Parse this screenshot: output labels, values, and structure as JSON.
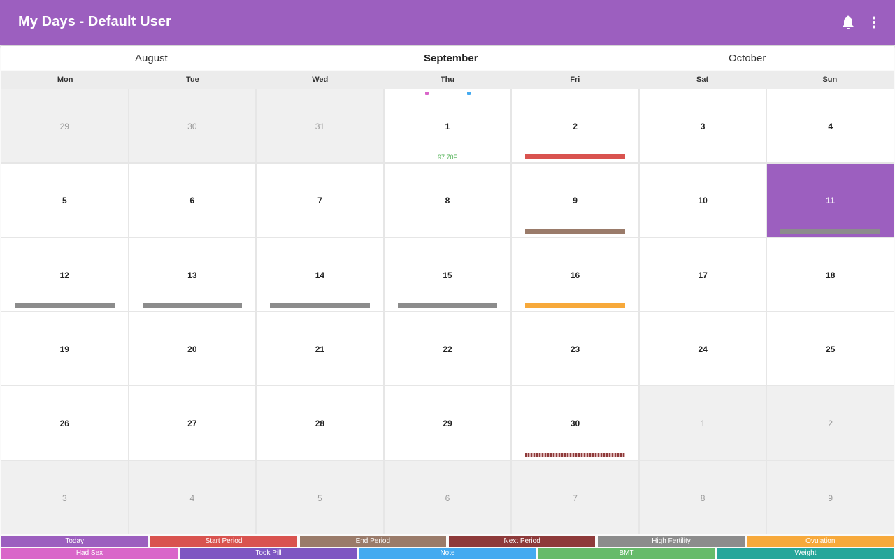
{
  "app": {
    "title": "My Days - Default User"
  },
  "icons": {
    "bell": "bell-icon",
    "more": "more-vert-icon"
  },
  "months": {
    "prev": "August",
    "current": "September",
    "next": "October"
  },
  "weekdays": [
    "Mon",
    "Tue",
    "Wed",
    "Thu",
    "Fri",
    "Sat",
    "Sun"
  ],
  "colors": {
    "accent": "#9c5fbf",
    "today": "#9c5fbf",
    "start_period": "#d9534f",
    "end_period": "#9a7b6a",
    "next_period": "#8e3a3a",
    "high_fertility": "#8c8c8c",
    "ovulation": "#f7a93b",
    "had_sex": "#d966c9",
    "took_pill": "#7e57c2",
    "note": "#44aaf0",
    "bbt": "#66bb6a",
    "weight": "#26a69a"
  },
  "days": [
    {
      "n": "29",
      "other": true
    },
    {
      "n": "30",
      "other": true
    },
    {
      "n": "31",
      "other": true
    },
    {
      "n": "1",
      "dots": [
        "sex",
        "note"
      ],
      "bbt": "97.70F"
    },
    {
      "n": "2",
      "bar": "startp"
    },
    {
      "n": "3"
    },
    {
      "n": "4"
    },
    {
      "n": "5"
    },
    {
      "n": "6"
    },
    {
      "n": "7"
    },
    {
      "n": "8"
    },
    {
      "n": "9",
      "bar": "endp"
    },
    {
      "n": "10"
    },
    {
      "n": "11",
      "today": true,
      "bar": "fert"
    },
    {
      "n": "12",
      "bar": "fert"
    },
    {
      "n": "13",
      "bar": "fert"
    },
    {
      "n": "14",
      "bar": "fert"
    },
    {
      "n": "15",
      "bar": "fert"
    },
    {
      "n": "16",
      "bar": "ovul"
    },
    {
      "n": "17"
    },
    {
      "n": "18"
    },
    {
      "n": "19"
    },
    {
      "n": "20"
    },
    {
      "n": "21"
    },
    {
      "n": "22"
    },
    {
      "n": "23"
    },
    {
      "n": "24"
    },
    {
      "n": "25"
    },
    {
      "n": "26"
    },
    {
      "n": "27"
    },
    {
      "n": "28"
    },
    {
      "n": "29"
    },
    {
      "n": "30",
      "bar": "next"
    },
    {
      "n": "1",
      "other": true
    },
    {
      "n": "2",
      "other": true
    },
    {
      "n": "3",
      "other": true
    },
    {
      "n": "4",
      "other": true
    },
    {
      "n": "5",
      "other": true
    },
    {
      "n": "6",
      "other": true
    },
    {
      "n": "7",
      "other": true
    },
    {
      "n": "8",
      "other": true
    },
    {
      "n": "9",
      "other": true
    }
  ],
  "legend_row1": [
    {
      "label": "Today",
      "color": "#9c5fbf"
    },
    {
      "label": "Start Period",
      "color": "#d9534f"
    },
    {
      "label": "End Period",
      "color": "#9a7b6a"
    },
    {
      "label": "Next Period",
      "color": "#8e3a3a"
    },
    {
      "label": "High Fertility",
      "color": "#8c8c8c"
    },
    {
      "label": "Ovulation",
      "color": "#f7a93b"
    }
  ],
  "legend_row2": [
    {
      "label": "Had Sex",
      "color": "#d966c9"
    },
    {
      "label": "Took Pill",
      "color": "#7e57c2"
    },
    {
      "label": "Note",
      "color": "#44aaf0"
    },
    {
      "label": "BMT",
      "color": "#66bb6a"
    },
    {
      "label": "Weight",
      "color": "#26a69a"
    }
  ]
}
